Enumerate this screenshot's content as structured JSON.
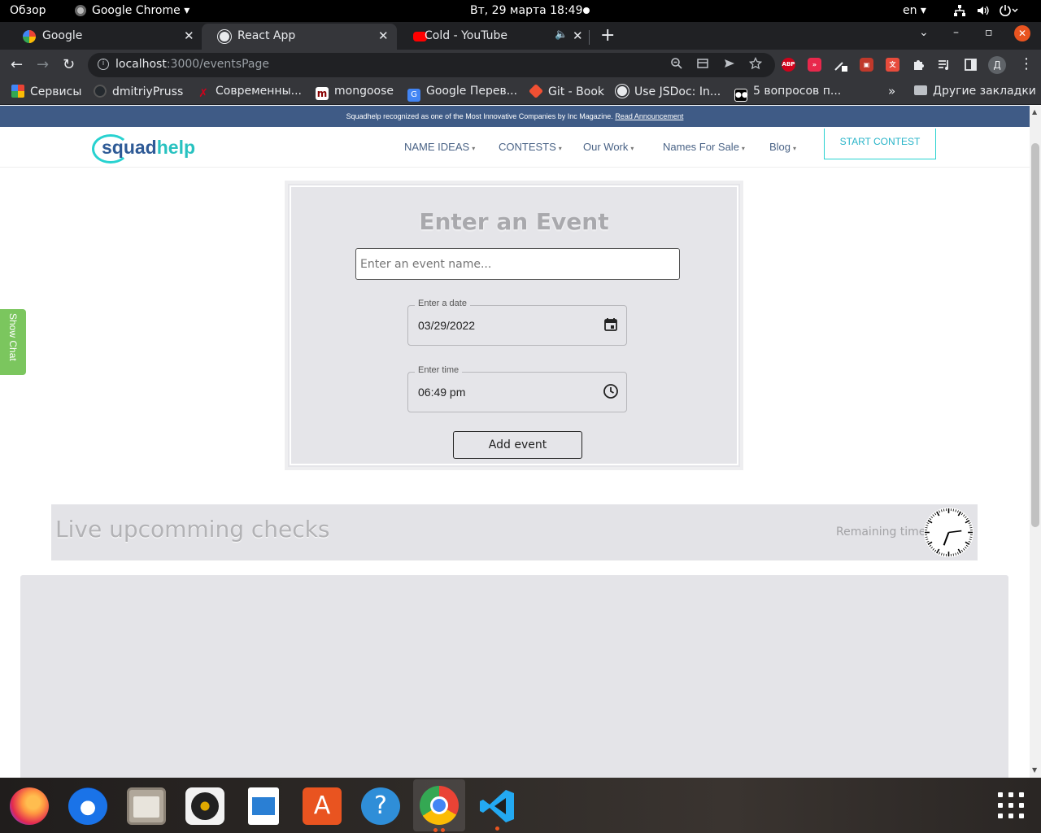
{
  "system_bar": {
    "overview": "Обзор",
    "app_name": "Google Chrome",
    "app_caret": "▾",
    "clock": "Вт, 29 марта  18:49",
    "lang": "en ▾"
  },
  "tabs": [
    {
      "title": "Google",
      "close": "✕"
    },
    {
      "title": "React App",
      "close": "✕"
    },
    {
      "title": "Cold - YouTube",
      "close": "✕",
      "audio": "🔈"
    }
  ],
  "new_tab": "+",
  "window_controls": {
    "down": "⌄",
    "minimize": "–",
    "maximize": "▫",
    "close": "✕"
  },
  "toolbar": {
    "back": "←",
    "forward": "→",
    "reload": "↻",
    "url_host": "localhost",
    "url_path": ":3000/eventsPage",
    "info": "i",
    "profile_initial": "Д",
    "menu": "⋮"
  },
  "bookmarks": [
    {
      "label": "Сервисы"
    },
    {
      "label": "dmitriyPruss"
    },
    {
      "label": "Современны..."
    },
    {
      "label": "mongoose"
    },
    {
      "label": "Google Перев..."
    },
    {
      "label": "Git - Book"
    },
    {
      "label": "Use JSDoc: In..."
    },
    {
      "label": "5 вопросов п..."
    }
  ],
  "bookmarks_more": "»",
  "other_bookmarks": "Другие закладки",
  "colors": {
    "announce_bg": "#3f5b86",
    "accent": "#28d2d0",
    "show_chat": "#7bc65e",
    "card_bg": "#e5e5e9"
  },
  "page": {
    "announcement_text": "Squadhelp recognized as one of the Most Innovative Companies by Inc Magazine.",
    "announcement_link": "Read Announcement",
    "logo_squad": "squad",
    "logo_help": "help",
    "nav": [
      {
        "label": "NAME IDEAS"
      },
      {
        "label": "CONTESTS"
      },
      {
        "label": "Our Work"
      },
      {
        "label": "Names For Sale"
      },
      {
        "label": "Blog"
      }
    ],
    "nav_caret": "▾",
    "start_contest": "START CONTEST",
    "show_chat": "Show Chat",
    "event_form": {
      "title": "Enter an Event",
      "name_placeholder": "Enter an event name...",
      "date_label": "Enter a date",
      "date_value": "03/29/2022",
      "time_label": "Enter time",
      "time_value": "06:49 pm",
      "add_button": "Add event"
    },
    "checks": {
      "title": "Live upcomming checks",
      "remaining_label": "Remaining time:"
    }
  },
  "dock": {
    "apps": [
      "firefox-icon",
      "thunderbird-icon",
      "files-icon",
      "rhythmbox-icon",
      "writer-icon",
      "software-icon",
      "help-icon",
      "chrome-icon",
      "vscode-icon"
    ],
    "help_glyph": "?"
  }
}
